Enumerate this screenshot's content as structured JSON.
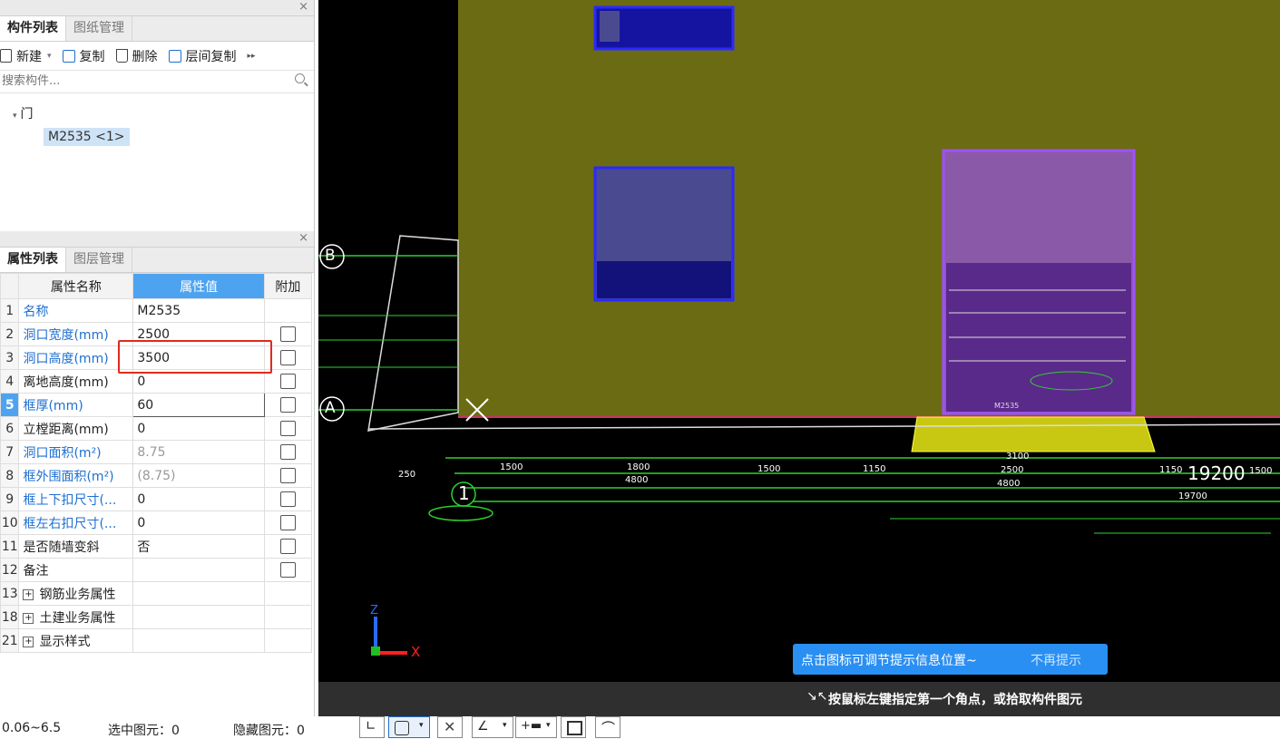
{
  "component_panel": {
    "tabs": [
      "构件列表",
      "图纸管理"
    ],
    "toolbar": {
      "new": "新建",
      "copy": "复制",
      "delete": "删除",
      "floor_copy": "层间复制"
    },
    "search_placeholder": "搜索构件...",
    "tree": {
      "category": "门",
      "item": "M2535 <1>"
    }
  },
  "property_panel": {
    "tabs": [
      "属性列表",
      "图层管理"
    ],
    "headers": {
      "name": "属性名称",
      "value": "属性值",
      "extra": "附加"
    },
    "rows": [
      {
        "num": "1",
        "name": "名称",
        "value": "M2535"
      },
      {
        "num": "2",
        "name": "洞口宽度(mm)",
        "value": "2500"
      },
      {
        "num": "3",
        "name": "洞口高度(mm)",
        "value": "3500"
      },
      {
        "num": "4",
        "name": "离地高度(mm)",
        "value": "0"
      },
      {
        "num": "5",
        "name": "框厚(mm)",
        "value": "60"
      },
      {
        "num": "6",
        "name": "立樘距离(mm)",
        "value": "0"
      },
      {
        "num": "7",
        "name": "洞口面积(m²)",
        "value": "8.75"
      },
      {
        "num": "8",
        "name": "框外围面积(m²)",
        "value": "(8.75)"
      },
      {
        "num": "9",
        "name": "框上下扣尺寸(...",
        "value": "0"
      },
      {
        "num": "10",
        "name": "框左右扣尺寸(...",
        "value": "0"
      },
      {
        "num": "11",
        "name": "是否随墙变斜",
        "value": "否"
      },
      {
        "num": "12",
        "name": "备注",
        "value": ""
      },
      {
        "num": "13",
        "name": "钢筋业务属性",
        "value": ""
      },
      {
        "num": "18",
        "name": "土建业务属性",
        "value": ""
      },
      {
        "num": "21",
        "name": "显示样式",
        "value": ""
      }
    ]
  },
  "canvas": {
    "axis_labels": {
      "b": "B",
      "a": "A",
      "one": "1",
      "z": "Z",
      "x": "X"
    },
    "dims": {
      "d1": "1500",
      "d2": "1800",
      "d3": "1500",
      "d4": "1150",
      "d5": "2500",
      "d6": "1150",
      "d7": "4800",
      "d8": "4800",
      "d9": "3100",
      "d10": "19200",
      "d11": "19700",
      "d12": "250",
      "d13": "1500"
    },
    "door_label": "M2535",
    "hint_text": "点击图标可调节提示信息位置~",
    "hint_dismiss": "不再提示",
    "command_prompt": "按鼠标左键指定第一个角点，或拾取构件图元"
  },
  "status": {
    "range": "0.06~6.5",
    "selected": "选中图元：0",
    "hidden": "隐藏图元：0"
  },
  "colors": {
    "accent": "#4ea3f0",
    "wall": "#6b6b14",
    "door": "#8a5aa8",
    "window": "#4a4a90",
    "highlight": "#e02a1e"
  }
}
